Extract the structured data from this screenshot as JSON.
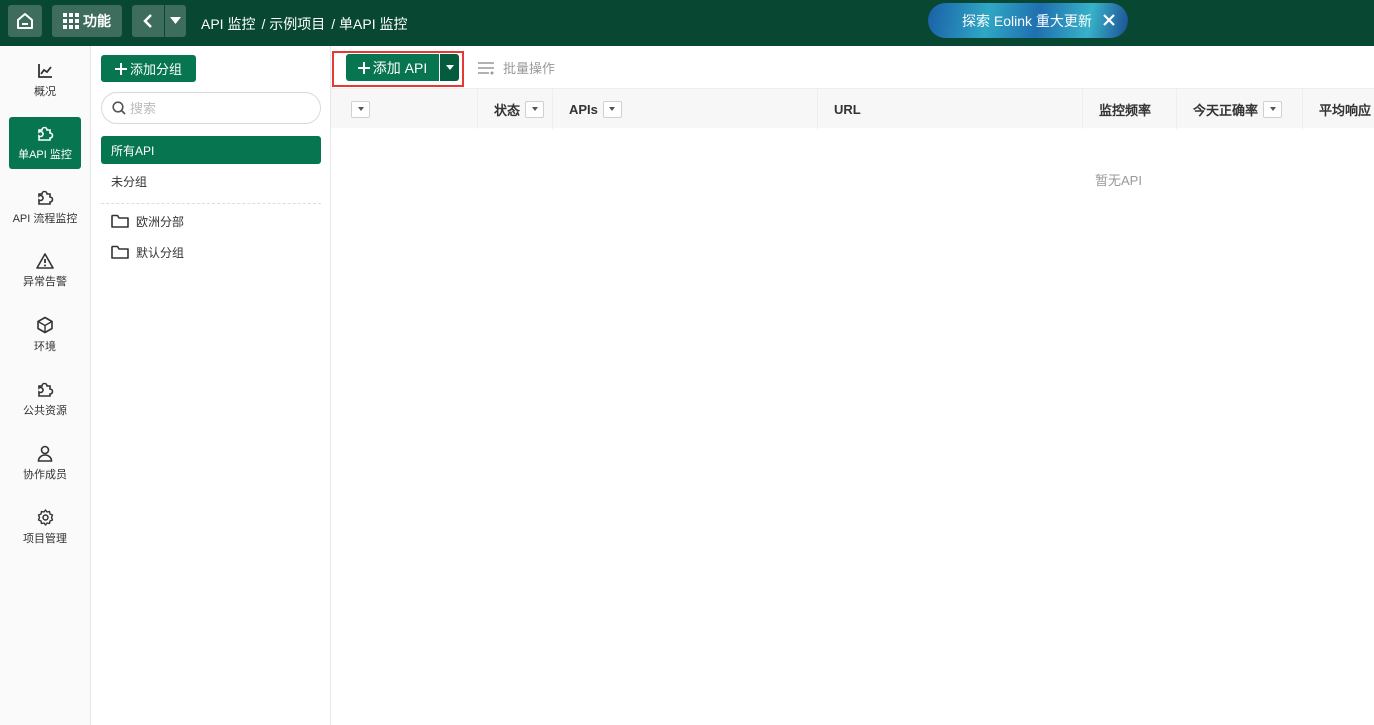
{
  "topbar": {
    "function_label": "功能",
    "breadcrumbs": [
      "API 监控",
      "/ 示例项目",
      "/ 单API 监控"
    ],
    "promo_text": "探索 Eolink 重大更新"
  },
  "leftnav": {
    "items": [
      {
        "label": "概况",
        "icon": "chart-line-icon",
        "active": false
      },
      {
        "label": "单API 监控",
        "icon": "puzzle-icon",
        "active": true
      },
      {
        "label": "API 流程监控",
        "icon": "puzzle-icon",
        "active": false
      },
      {
        "label": "异常告警",
        "icon": "warning-triangle-icon",
        "active": false
      },
      {
        "label": "环境",
        "icon": "cube-icon",
        "active": false
      },
      {
        "label": "公共资源",
        "icon": "puzzle-icon",
        "active": false
      },
      {
        "label": "协作成员",
        "icon": "user-icon",
        "active": false
      },
      {
        "label": "项目管理",
        "icon": "gear-icon",
        "active": false
      }
    ]
  },
  "groups": {
    "add_label": "添加分组",
    "search_placeholder": "搜索",
    "items": [
      "所有API",
      "未分组"
    ],
    "active_item": "所有API",
    "folders": [
      "欧洲分部",
      "默认分组"
    ]
  },
  "toolbar": {
    "add_api_label": "添加 API",
    "batch_label": "批量操作"
  },
  "table": {
    "columns": [
      "状态",
      "APIs",
      "URL",
      "监控频率",
      "今天正确率",
      "平均响应"
    ],
    "empty_text": "暂无API"
  },
  "colors": {
    "topbar_bg": "#084832",
    "primary": "#07754f",
    "highlight_border": "#e53935"
  }
}
